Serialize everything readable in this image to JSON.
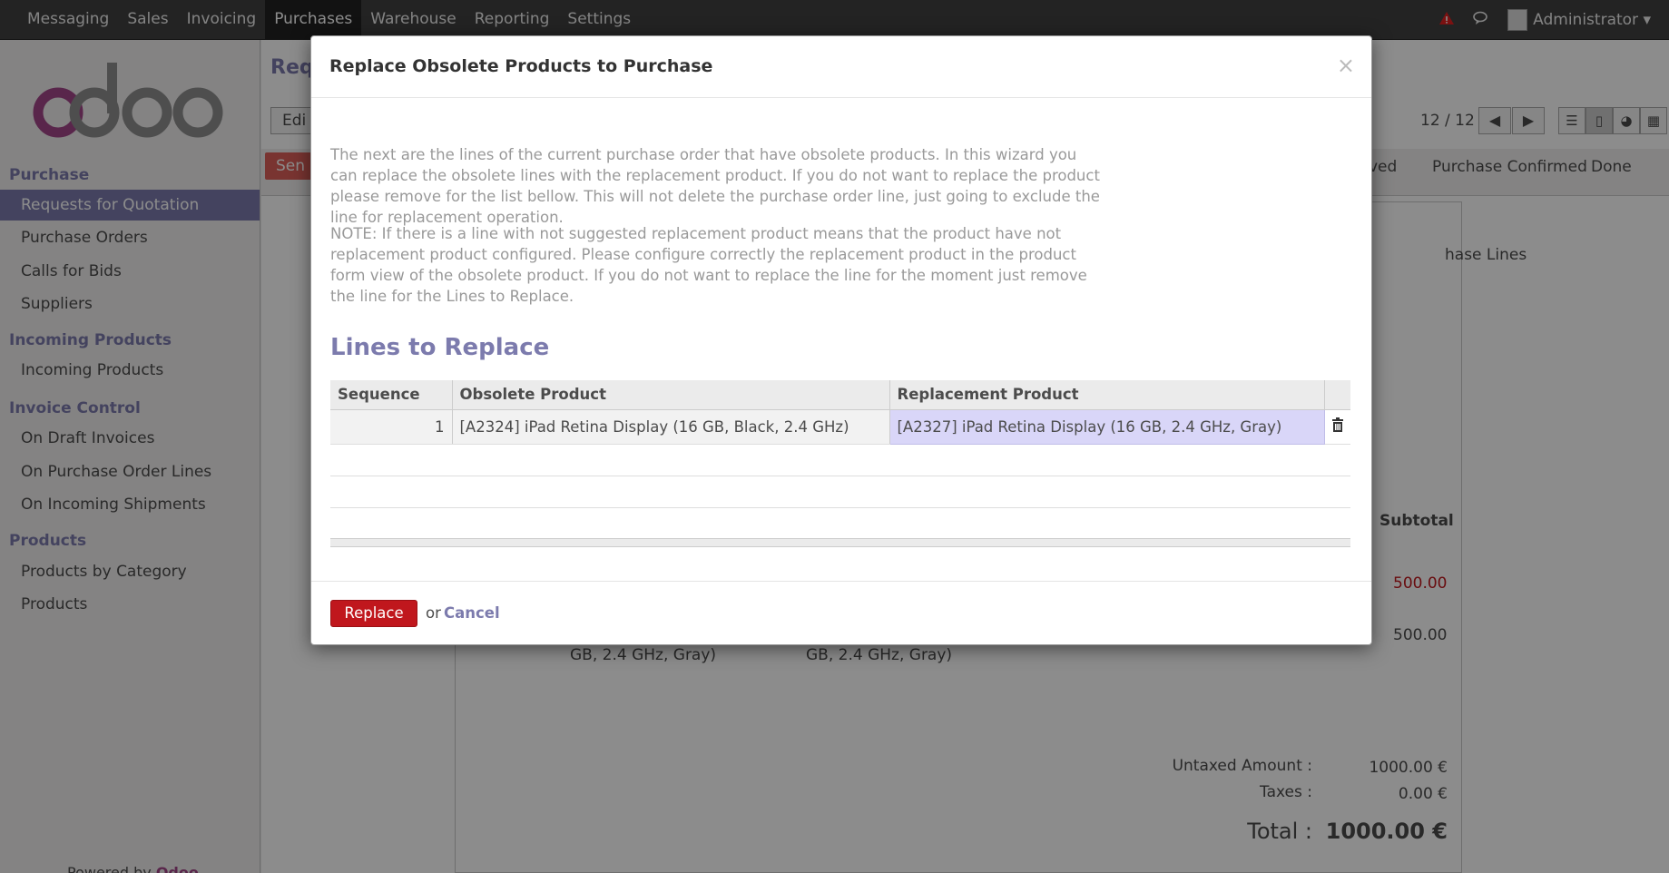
{
  "topbar": {
    "menu": [
      "Messaging",
      "Sales",
      "Invoicing",
      "Purchases",
      "Warehouse",
      "Reporting",
      "Settings"
    ],
    "active": "Purchases",
    "user": "Administrator",
    "alert_icon": "warning-triangle-icon",
    "chat_icon": "chat-bubbles-icon"
  },
  "sidebar": {
    "logo_text": "odoo",
    "groups": [
      {
        "label": "Purchase",
        "items": [
          "Requests for Quotation",
          "Purchase Orders",
          "Calls for Bids",
          "Suppliers"
        ]
      },
      {
        "label": "Incoming Products",
        "items": [
          "Incoming Products"
        ]
      },
      {
        "label": "Invoice Control",
        "items": [
          "On Draft Invoices",
          "On Purchase Order Lines",
          "On Incoming Shipments"
        ]
      },
      {
        "label": "Products",
        "items": [
          "Products by Category",
          "Products"
        ]
      }
    ],
    "active_item": "Requests for Quotation",
    "powered_by": "Powered by",
    "powered_brand": "Odoo"
  },
  "main": {
    "title": "Req",
    "edit_label": "Edi",
    "send_label": "Sen",
    "pager": "12 / 12",
    "stages": [
      "ved",
      "Purchase Confirmed",
      "Done"
    ],
    "tab_label": "hase Lines",
    "subtotal_header": "Subtotal",
    "line1_subtotal": "500.00",
    "line2_subtotal": "500.00",
    "line2_desc_a": "GB, 2.4 GHz, Gray)",
    "line2_desc_b": "GB, 2.4 GHz, Gray)",
    "untaxed_label": "Untaxed Amount :",
    "untaxed_value": "1000.00 €",
    "taxes_label": "Taxes :",
    "taxes_value": "0.00 €",
    "total_label": "Total :",
    "total_value": "1000.00 €"
  },
  "modal": {
    "title": "Replace Obsolete Products to Purchase",
    "close": "×",
    "para1": "The next are the lines of the current purchase order that have obsolete products. In this wizard you can replace the obsolete lines with the replacement product. If you do not want to replace the product please remove for the list bellow. This will not delete the purchase order line, just going to exclude the line for replacement operation.",
    "para2": "NOTE: If there is a line with not suggested replacement product means that the product have not replacement product configured. Please configure correctly the replacement product in the product form view of the obsolete product. If you do not want to replace the line for the moment just remove the line for the Lines to Replace.",
    "section_title": "Lines to Replace",
    "columns": {
      "sequence": "Sequence",
      "obsolete": "Obsolete Product",
      "replacement": "Replacement Product"
    },
    "rows": [
      {
        "sequence": "1",
        "obsolete": "[A2324] iPad Retina Display (16 GB, Black, 2.4 GHz)",
        "replacement": "[A2327] iPad Retina Display (16 GB, 2.4 GHz, Gray)"
      }
    ],
    "replace_label": "Replace",
    "or_label": "or",
    "cancel_label": "Cancel"
  }
}
